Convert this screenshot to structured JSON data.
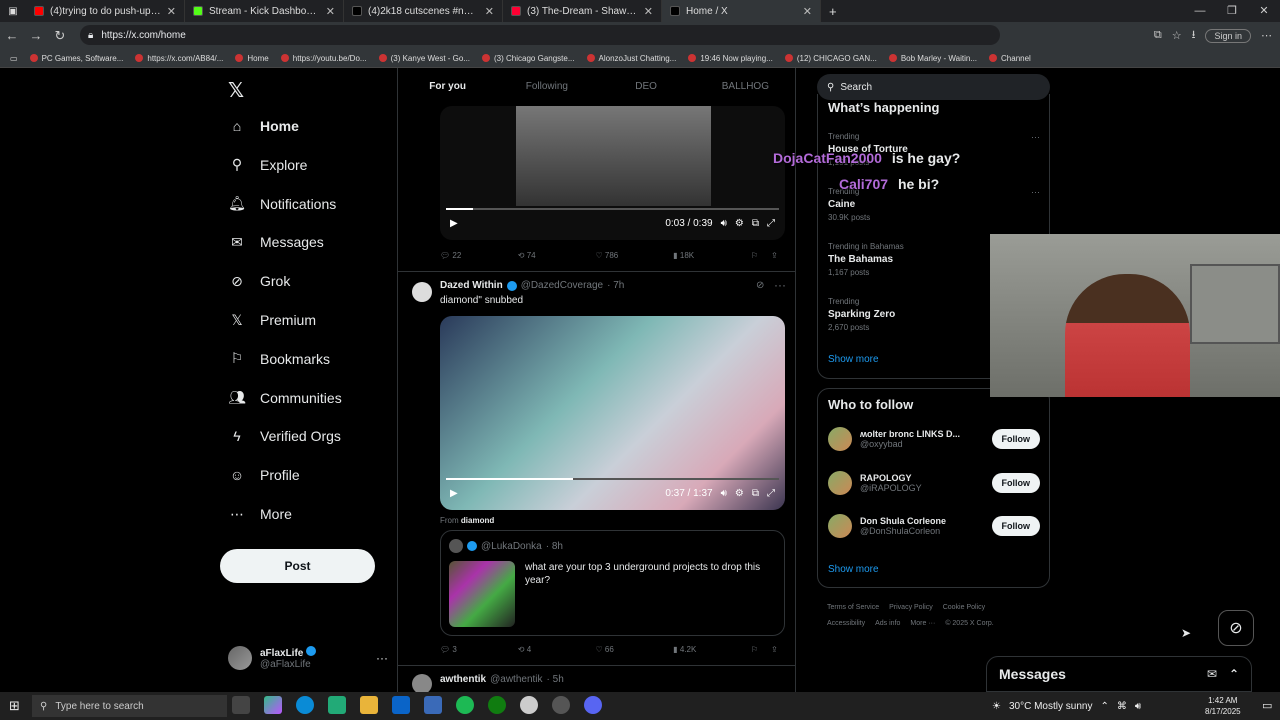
{
  "browser": {
    "tabs": [
      {
        "title": "(4)trying to do push-ups for bee",
        "color": "#ff0000"
      },
      {
        "title": "Stream - Kick Dashboard",
        "color": "#53fc18"
      },
      {
        "title": "(4)2k18 cutscenes #nba2k #nba2",
        "color": "#000000"
      },
      {
        "title": "(3) The-Dream - Shawty Is A 10",
        "color": "#ff0033"
      },
      {
        "title": "Home / X",
        "color": "#000000"
      }
    ],
    "url": "https://x.com/home",
    "sign_in": "Sign in",
    "bookmarks": [
      "PC Games, Software...",
      "https://x.com/AB84/...",
      "Home",
      "https://youtu.be/Do...",
      "(3) Kanye West - Go...",
      "(3) Chicago Gangste...",
      "AlonzoJust Chatting...",
      "19:46 Now playing...",
      "(12) CHICAGO GAN...",
      "Bob Marley - Waitin...",
      "Channel"
    ]
  },
  "nav": {
    "items": [
      {
        "label": "Home",
        "icon": "home-icon",
        "glyph": "⌂"
      },
      {
        "label": "Explore",
        "icon": "search-icon",
        "glyph": "⚲"
      },
      {
        "label": "Notifications",
        "icon": "bell-icon",
        "glyph": "🔔︎"
      },
      {
        "label": "Messages",
        "icon": "mail-icon",
        "glyph": "✉"
      },
      {
        "label": "Grok",
        "icon": "grok-icon",
        "glyph": "⊘"
      },
      {
        "label": "Premium",
        "icon": "x-logo-icon",
        "glyph": "𝕏"
      },
      {
        "label": "Bookmarks",
        "icon": "bookmark-icon",
        "glyph": "⚐"
      },
      {
        "label": "Communities",
        "icon": "people-icon",
        "glyph": "👥︎"
      },
      {
        "label": "Verified Orgs",
        "icon": "lightning-icon",
        "glyph": "ϟ"
      },
      {
        "label": "Profile",
        "icon": "person-icon",
        "glyph": "☺"
      },
      {
        "label": "More",
        "icon": "more-circle-icon",
        "glyph": "⋯"
      }
    ],
    "post_label": "Post",
    "account": {
      "name": "aFlaxLife",
      "handle": "@aFlaxLife"
    }
  },
  "feed": {
    "tabs": [
      "For you",
      "Following",
      "DEO",
      "BALLHOG"
    ],
    "video1": {
      "time": "0:03 / 0:39",
      "progress": 0.08
    },
    "tweet1_actions": {
      "replies": "22",
      "reposts": "74",
      "likes": "786",
      "views": "18K"
    },
    "tweet2": {
      "name": "Dazed Within",
      "handle": "@DazedCoverage",
      "time": "· 7h",
      "text": "diamond\" snubbed",
      "video_time": "0:37 / 1:37",
      "progress": 0.38,
      "from_prefix": "From",
      "from_name": "diamond",
      "quote": {
        "handle": "@LukaDonka",
        "time": "· 8h",
        "text": "what are your top 3 underground projects to drop this year?"
      },
      "actions": {
        "replies": "3",
        "reposts": "4",
        "likes": "66",
        "views": "4.2K"
      }
    },
    "tweet3": {
      "name": "awthentik",
      "handle": "@awthentik",
      "time": "· 5h"
    }
  },
  "right": {
    "search_placeholder": "Search",
    "happening_title": "What’s happening",
    "trends": [
      {
        "context": "Trending",
        "title": "House of Torture",
        "posts": "1,151 posts"
      },
      {
        "context": "Trending",
        "title": "Caine",
        "posts": "30.9K posts"
      },
      {
        "context": "Trending in Bahamas",
        "title": "The Bahamas",
        "posts": "1,167 posts"
      },
      {
        "context": "Trending",
        "title": "Sparking Zero",
        "posts": "2,670 posts"
      }
    ],
    "show_more": "Show more",
    "wtf_title": "Who to follow",
    "follow_label": "Follow",
    "follows": [
      {
        "name": "ʍolter bronc  LINKS D...",
        "handle": "@oxyybad"
      },
      {
        "name": "RAPOLOGY",
        "handle": "@iRAPOLOGY"
      },
      {
        "name": "Don Shula Corleone",
        "handle": "@DonShulaCorleon"
      }
    ],
    "footer": [
      "Terms of Service",
      "Privacy Policy",
      "Cookie Policy",
      "Accessibility",
      "Ads info",
      "More ···",
      "© 2025 X Corp."
    ]
  },
  "overlay": {
    "chat": [
      {
        "user": "DojaCatFan2000",
        "msg": "is he gay?"
      },
      {
        "user": "Cali707",
        "msg": "he bi?"
      }
    ],
    "user_color": "#b36bd9"
  },
  "messages_drawer": {
    "title": "Messages"
  },
  "taskbar": {
    "search_placeholder": "Type here to search",
    "weather": "30°C  Mostly sunny",
    "time": "1:42 AM",
    "date": "8/17/2025"
  }
}
